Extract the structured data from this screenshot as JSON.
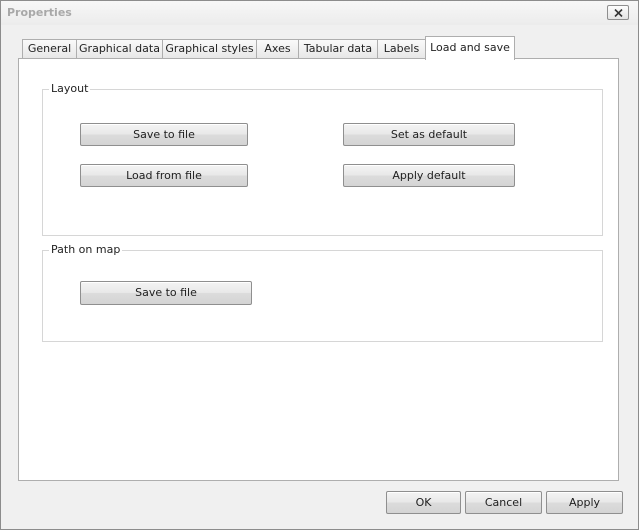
{
  "window": {
    "title": "Properties"
  },
  "tabs": [
    {
      "label": "General"
    },
    {
      "label": "Graphical data"
    },
    {
      "label": "Graphical styles"
    },
    {
      "label": "Axes"
    },
    {
      "label": "Tabular data"
    },
    {
      "label": "Labels"
    },
    {
      "label": "Load and save",
      "active": true
    }
  ],
  "layout_group": {
    "title": "Layout",
    "save_to_file": "Save to file",
    "load_from_file": "Load from file",
    "set_as_default": "Set as default",
    "apply_default": "Apply default"
  },
  "path_group": {
    "title": "Path on map",
    "save_to_file": "Save to file"
  },
  "footer": {
    "ok": "OK",
    "cancel": "Cancel",
    "apply": "Apply"
  },
  "icons": {
    "close": "close-icon"
  }
}
